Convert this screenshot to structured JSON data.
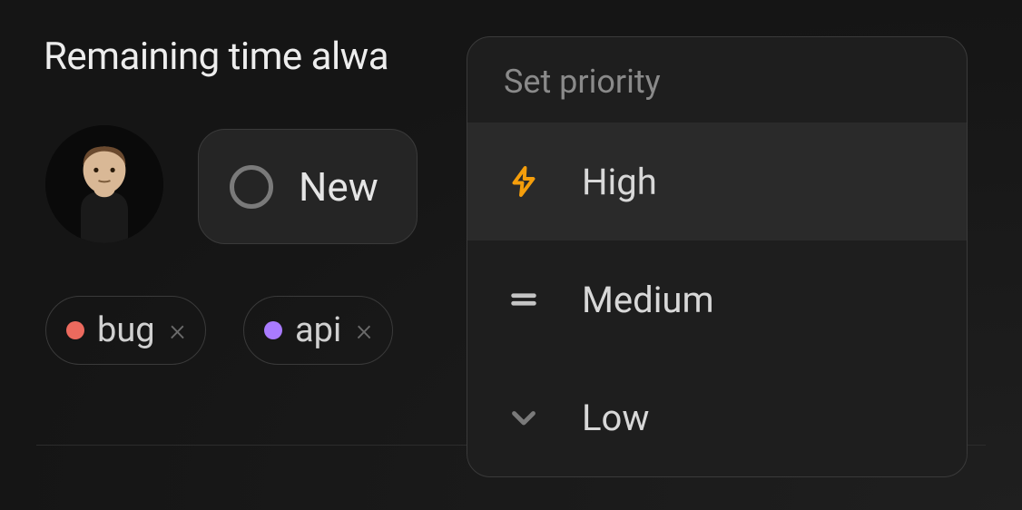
{
  "title": "Remaining time alwa",
  "status": {
    "label": "New"
  },
  "tags": [
    {
      "label": "bug",
      "color": "#ec6a5e"
    },
    {
      "label": "api",
      "color": "#a97bff"
    }
  ],
  "popover": {
    "title": "Set priority",
    "options": [
      {
        "label": "High",
        "icon": "lightning-icon",
        "color": "#f59e0b",
        "selected": true
      },
      {
        "label": "Medium",
        "icon": "equals-icon",
        "color": "#c5c5c5",
        "selected": false
      },
      {
        "label": "Low",
        "icon": "chevron-down-icon",
        "color": "#7a7a7a",
        "selected": false
      }
    ]
  }
}
